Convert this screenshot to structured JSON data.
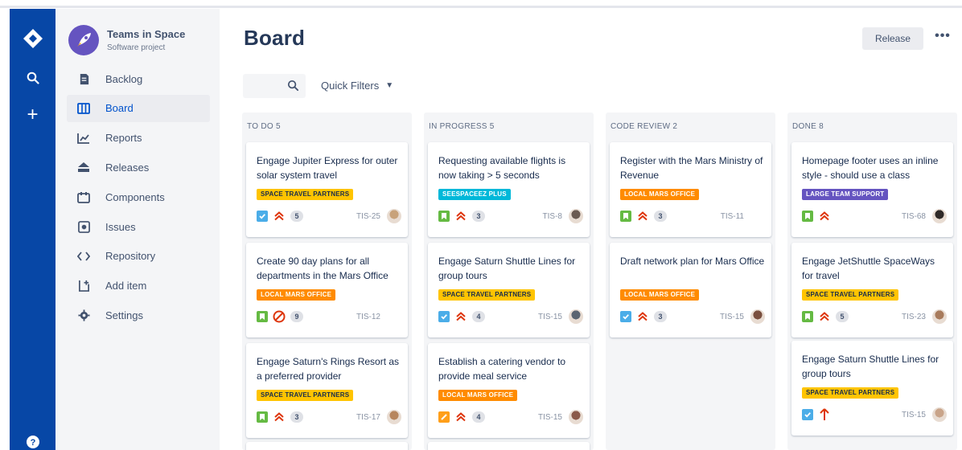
{
  "app": {
    "logo_icon": "jira-logo-icon",
    "search_icon": "search-icon",
    "create_icon": "plus-icon",
    "help_icon": "help-icon"
  },
  "project": {
    "name": "Teams in Space",
    "type": "Software project"
  },
  "sidebar": {
    "items": [
      {
        "label": "Backlog",
        "icon": "backlog-icon"
      },
      {
        "label": "Board",
        "icon": "board-icon",
        "active": true
      },
      {
        "label": "Reports",
        "icon": "reports-icon"
      },
      {
        "label": "Releases",
        "icon": "releases-icon"
      },
      {
        "label": "Components",
        "icon": "components-icon"
      },
      {
        "label": "Issues",
        "icon": "issues-icon"
      },
      {
        "label": "Repository",
        "icon": "repository-icon"
      },
      {
        "label": "Add item",
        "icon": "add-item-icon"
      },
      {
        "label": "Settings",
        "icon": "settings-icon"
      }
    ]
  },
  "header": {
    "title": "Board",
    "release_label": "Release",
    "more_label": "•••"
  },
  "filters": {
    "quick_filters_label": "Quick Filters"
  },
  "colors": {
    "global_nav": "#0747a6",
    "sidebar_bg": "#f4f5f7",
    "active_text": "#0052cc",
    "label_yellow": "#ffc400",
    "label_orange": "#ff8b00",
    "label_teal": "#00b8d9",
    "label_purple": "#6554c0",
    "priority_red": "#de350b",
    "task_blue": "#4bade8",
    "story_green": "#65ba43"
  },
  "columns": [
    {
      "name": "TO DO",
      "count": "5",
      "cards": [
        {
          "title": "Engage Jupiter Express for outer solar system travel",
          "label": "SPACE TRAVEL PARTNERS",
          "label_color": "yellow",
          "type": "task",
          "priority": "high",
          "estimate": "5",
          "key": "TIS-25",
          "avatar": "#c8a27a"
        },
        {
          "title": "Create 90 day plans for all departments in the Mars Office",
          "label": "LOCAL MARS OFFICE",
          "label_color": "orange",
          "type": "story",
          "priority": "blocker",
          "estimate": "9",
          "key": "TIS-12",
          "avatar": ""
        },
        {
          "title": "Engage Saturn's Rings Resort as a preferred provider",
          "label": "SPACE TRAVEL PARTNERS",
          "label_color": "yellow",
          "type": "story",
          "priority": "high",
          "estimate": "3",
          "key": "TIS-17",
          "avatar": "#b7865e"
        }
      ]
    },
    {
      "name": "IN PROGRESS",
      "count": "5",
      "cards": [
        {
          "title": "Requesting available flights is now taking > 5 seconds",
          "label": "SEESPACEEZ PLUS",
          "label_color": "teal",
          "type": "story",
          "priority": "high",
          "estimate": "3",
          "key": "TIS-8",
          "avatar": "#6b5b52"
        },
        {
          "title": "Engage Saturn Shuttle Lines for group tours",
          "label": "SPACE TRAVEL PARTNERS",
          "label_color": "yellow",
          "type": "task",
          "priority": "high",
          "estimate": "4",
          "key": "TIS-15",
          "avatar": "#5b6572"
        },
        {
          "title": "Establish a catering vendor to provide meal service",
          "label": "LOCAL MARS OFFICE",
          "label_color": "orange",
          "type": "bug",
          "priority": "high",
          "estimate": "4",
          "key": "TIS-15",
          "avatar": "#8b5a4a"
        }
      ]
    },
    {
      "name": "CODE REVIEW",
      "count": "2",
      "cards": [
        {
          "title": "Register with the Mars Ministry of Revenue",
          "label": "LOCAL MARS OFFICE",
          "label_color": "orange",
          "type": "story",
          "priority": "high",
          "estimate": "3",
          "key": "TIS-11",
          "avatar": ""
        },
        {
          "title": "Draft network plan for Mars Office",
          "label": "LOCAL MARS OFFICE",
          "label_color": "orange",
          "type": "task",
          "priority": "high",
          "estimate": "3",
          "key": "TIS-15",
          "avatar": "#7a4f3f"
        }
      ]
    },
    {
      "name": "DONE",
      "count": "8",
      "cards": [
        {
          "title": "Homepage footer uses an inline style - should use a class",
          "label": "LARGE TEAM SUPPORT",
          "label_color": "purple",
          "type": "story",
          "priority": "high",
          "estimate": "",
          "key": "TIS-68",
          "avatar": "#2f2a28"
        },
        {
          "title": "Engage JetShuttle SpaceWays for travel",
          "label": "SPACE TRAVEL PARTNERS",
          "label_color": "yellow",
          "type": "story",
          "priority": "high",
          "estimate": "5",
          "key": "TIS-23",
          "avatar": "#a87b5c"
        },
        {
          "title": "Engage Saturn Shuttle Lines for group tours",
          "label": "SPACE TRAVEL PARTNERS",
          "label_color": "yellow",
          "type": "task",
          "priority": "highest",
          "estimate": "",
          "key": "TIS-15",
          "avatar": "#c9a489"
        }
      ]
    }
  ]
}
